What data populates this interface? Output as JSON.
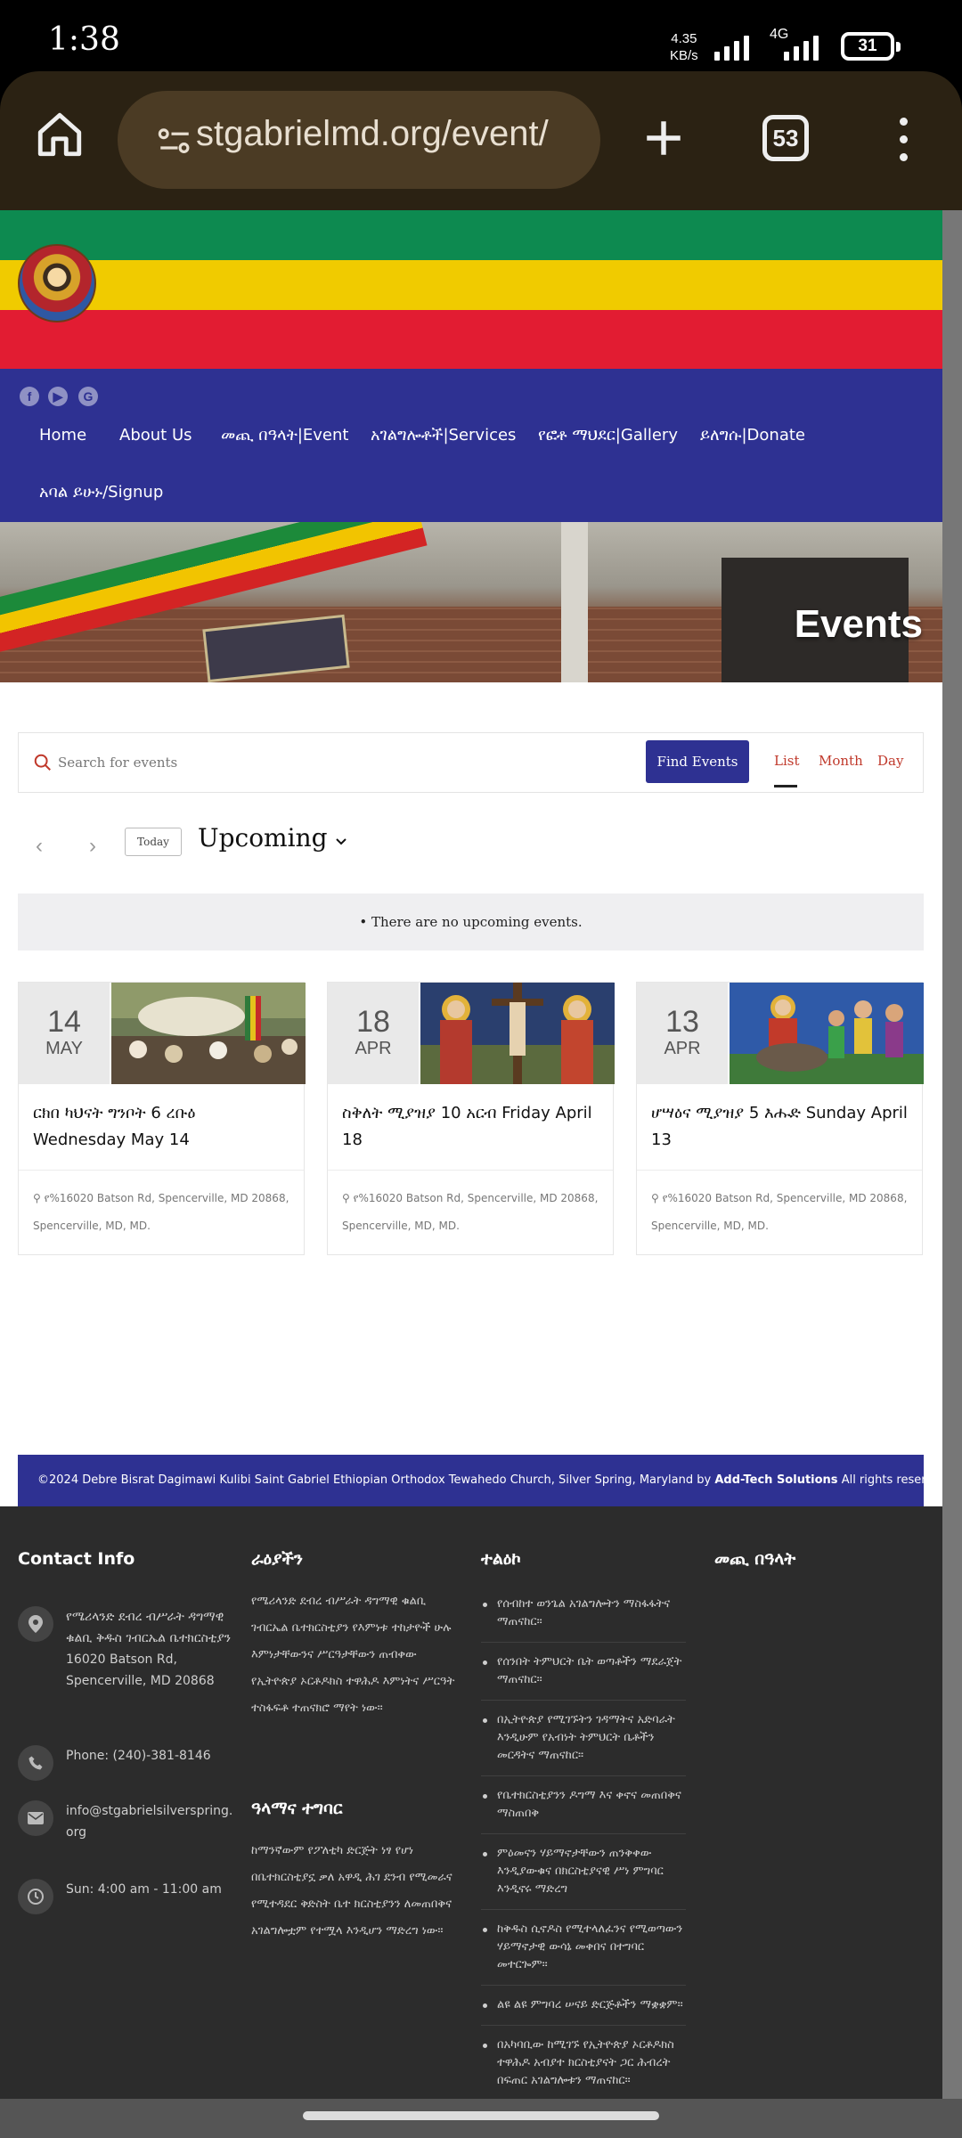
{
  "status": {
    "time": "1:38",
    "speed_value": "4.35",
    "speed_unit": "KB/s",
    "network": "4G",
    "battery": "31"
  },
  "browser": {
    "url": "stgabrielmd.org/event/",
    "tab_count": "53"
  },
  "social": {
    "facebook": "f",
    "youtube": "▶",
    "google": "G"
  },
  "nav": [
    {
      "label": "Home"
    },
    {
      "label": "About Us"
    },
    {
      "label": "መጪ በዓላት|Event"
    },
    {
      "label": "አገልግሎቶች|Services"
    },
    {
      "label": "የፎቶ ማህደር|Gallery"
    },
    {
      "label": "ይለግሱ|Donate"
    },
    {
      "label": "አባል ይሁኑ/Signup"
    }
  ],
  "hero": {
    "title": "Events"
  },
  "search": {
    "placeholder": "Search for events",
    "button": "Find Events"
  },
  "views": {
    "list": "List",
    "month": "Month",
    "day": "Day"
  },
  "toolbar": {
    "prev": "‹",
    "next": "›",
    "today": "Today",
    "upcoming": "Upcoming"
  },
  "notice": "• There are no upcoming events.",
  "events": [
    {
      "day": "14",
      "month": "MAY",
      "title": "ርክበ ካህናት ግንቦት 6 ረቡዕ Wednesday May 14",
      "location": "የ%16020 Batson Rd, Spencerville, MD 20868, Spencerville, MD, MD."
    },
    {
      "day": "18",
      "month": "APR",
      "title": "ስቅለት ሚያዝያ 10 አርብ Friday April 18",
      "location": "የ%16020 Batson Rd, Spencerville, MD 20868, Spencerville, MD, MD."
    },
    {
      "day": "13",
      "month": "APR",
      "title": "ሆሣዕና ሚያዝያ 5 እሑድ Sunday April 13",
      "location": "የ%16020 Batson Rd, Spencerville, MD 20868, Spencerville, MD, MD."
    }
  ],
  "credits": {
    "text": "©2024 Debre Bisrat Dagimawi Kulibi Saint Gabriel Ethiopian Orthodox Tewahedo Church, Silver Spring, Maryland by",
    "company": "Add-Tech Solutions",
    "suffix": "All rights reserved."
  },
  "footer": {
    "contact_title": "Contact Info",
    "address": "የሜሪላንድ ደብረ ብሥራት ዳግማዊ ቁልቢ ቅዱስ ገብርኤል ቤተክርስቲያን 16020 Batson Rd, Spencerville, MD 20868",
    "phone": "Phone: (240)-381-8146",
    "email": "info@stgabrielsilverspring.org",
    "hours": "Sun: 4:00 am - 11:00 am",
    "vision_title": "ራዕያችን",
    "vision_text": "የሜሪላንድ ደብረ ብሥራት ዳግማዊ ቁልቢ ገብርኤል ቤተክርስቲያን የእምነቱ ተከታዮች ሁሉ እምነታቸውንና ሥርዓታቸውን ጠብቀው የኢትዮጵያ ኦርቶዶክስ ተዋሕዶ እምነትና ሥርዓት ተስፋፍቶ ተጠናክሮ ማየት ነው።",
    "mission_title": "ዓላማና ተግባር",
    "mission_text": "ከማንኛውም የፖለቲካ ድርጅት ነፃ የሆነ በቤተክርስቲያኗ ቃለ አዋዲ ሕገ ደንብ የሚመራና የሚተዳደር ቅድስት ቤተ ክርስቲያንን ለመጠበቅና አገልግሎቷም የተሟላ እንዲሆን ማድረግ ነው።",
    "tasks_title": "ተልዕኮ",
    "tasks": [
      "የሰብከተ ወንጌል አገልግሎትን ማስፋፋትና ማጠናከር።",
      "የሰንበት ትምህርት ቤት ወጣቶችን ማደራጀት ማጠናከር።",
      "በኢትዮጵያ የሚገኙትን ገዳማትና አድባራት እንዲሁም የአብነት ትምህርት ቤቶችን መርዳትና ማጠናከር።",
      "የቤተክርስቲያንን ዶግማ እና ቀኖና መጠበቅና ማስጠበቅ",
      "ምዕመናን ሃይማኖታቸውን ጠንቅቀው እንዲያውቁና በክርስቲያናዊ ሥነ ምግባር እንዲኖሩ ማድረግ",
      "ከቅዱስ ሲኖዶስ የሚተላለፈንና የሚወጣውን ሃይማኖታዊ ውሳኔ መቀበና በተግባር መተርጐም።",
      "ልዩ ልዩ ምግባረ ሠናይ ድርጅቶችን ማቋቋም።",
      "በአካባቢው ከሚገኙ የኢትዮጵያ ኦርቶዶክስ ተዋሕዶ አብያተ ክርስቲያናት ጋር ሕብረት በፍጠር አገልግሎቱን ማጠናከር።"
    ],
    "events_title": "መጪ በዓላት"
  },
  "colors": {
    "primary": "#2e3192",
    "accent": "#c0392b",
    "flag_green": "#0d8a50",
    "flag_yellow": "#f0cb00",
    "flag_red": "#e21c32"
  }
}
